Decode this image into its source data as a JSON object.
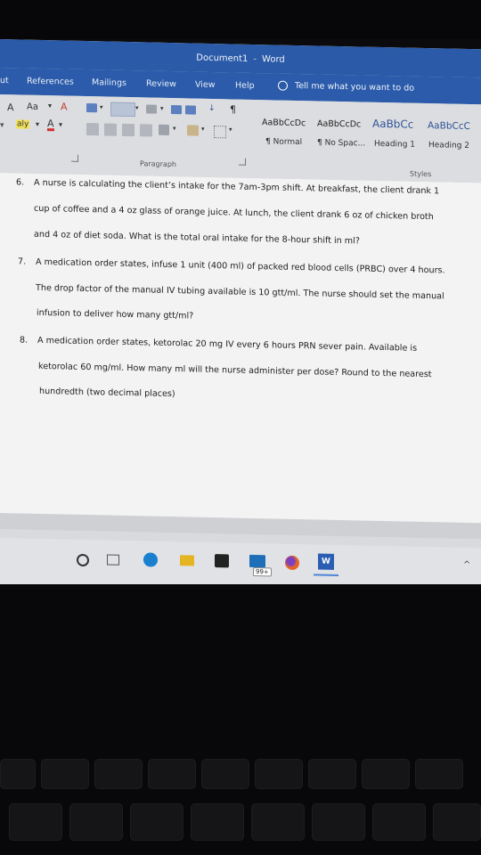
{
  "window": {
    "title": "Document1",
    "separator": "-",
    "app": "Word"
  },
  "tabs": [
    {
      "label": "ut"
    },
    {
      "label": "References"
    },
    {
      "label": "Mailings"
    },
    {
      "label": "Review"
    },
    {
      "label": "View"
    },
    {
      "label": "Help"
    }
  ],
  "tell_me": "Tell me what you want to do",
  "ribbon": {
    "font_row": {
      "grow": "A",
      "case": "Aa",
      "highlight": "aly",
      "font_color": "A"
    },
    "paragraph_label": "Paragraph",
    "styles_label": "Styles",
    "styles": [
      {
        "preview": "AaBbCcDc",
        "name": "¶ Normal"
      },
      {
        "preview": "AaBbCcDc",
        "name": "¶ No Spac..."
      },
      {
        "preview": "AaBbCc",
        "name": "Heading 1"
      },
      {
        "preview": "AaBbCcC",
        "name": "Heading 2"
      }
    ]
  },
  "document": {
    "questions": [
      {
        "number": "6.",
        "lines": [
          "A nurse is calculating the client’s intake for the 7am-3pm shift. At breakfast, the client drank 1",
          "cup of coffee and a 4 oz glass of orange juice. At lunch, the client drank 6 oz of chicken broth",
          "and 4 oz of diet soda. What is the total oral intake for the 8-hour shift in ml?"
        ]
      },
      {
        "number": "7.",
        "lines": [
          "A medication order states, infuse 1 unit (400 ml) of packed red blood cells (PRBC) over 4 hours.",
          "The drop factor of the manual IV tubing available is 10 gtt/ml. The nurse should set the manual",
          "infusion to deliver how many gtt/ml?"
        ]
      },
      {
        "number": "8.",
        "lines": [
          "A medication order states, ketorolac 20 mg IV every 6 hours PRN sever pain. Available is",
          "ketorolac 60 mg/ml. How many ml will the nurse administer per dose? Round to the nearest",
          "hundredth (two decimal places)"
        ]
      }
    ]
  },
  "taskbar": {
    "mail_badge": "99+",
    "word_label": "W",
    "overflow": "^"
  }
}
